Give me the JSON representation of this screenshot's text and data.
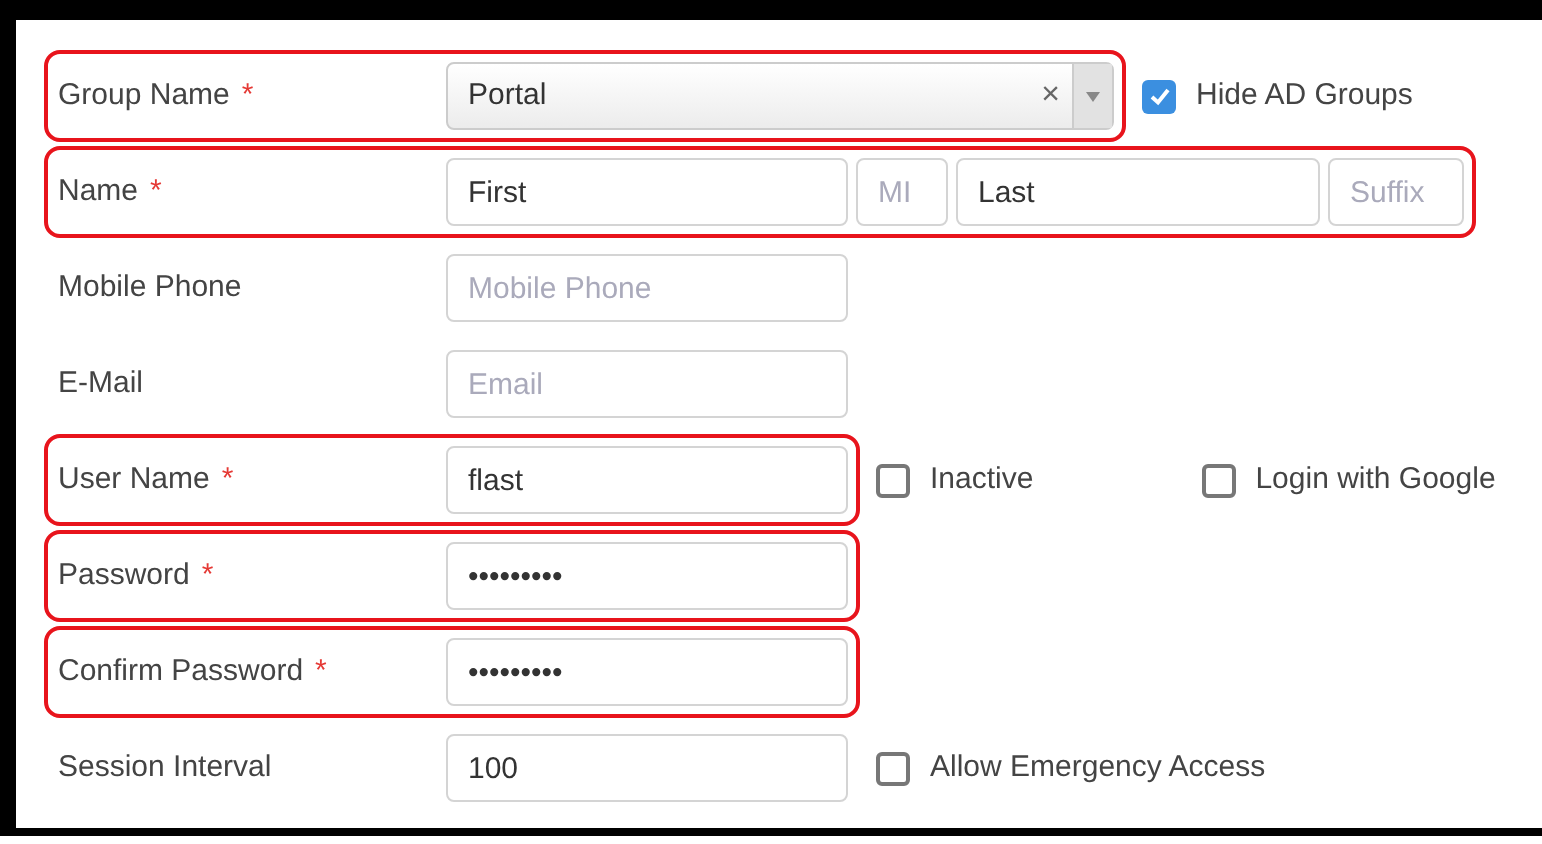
{
  "form": {
    "rows": [
      {
        "kind": "select",
        "label": "Group Name",
        "marker": "*",
        "highlighted": true,
        "value": "Portal",
        "clear": "×",
        "checkboxes": [
          {
            "label": "Hide AD Groups",
            "checked": true
          }
        ]
      },
      {
        "kind": "inputs",
        "label": "Name",
        "marker": "*",
        "highlighted": true,
        "inputs": [
          {
            "kind": "wide",
            "value": "First"
          },
          {
            "kind": "narrow",
            "placeholder": "MI"
          },
          {
            "kind": "medium",
            "value": "Last"
          },
          {
            "kind": "small",
            "placeholder": "Suffix"
          }
        ]
      },
      {
        "kind": "inputs",
        "label": "Mobile Phone",
        "highlighted": false,
        "inputs": [
          {
            "kind": "wide",
            "placeholder": "Mobile Phone"
          }
        ]
      },
      {
        "kind": "inputs",
        "label": "E-Mail",
        "highlighted": false,
        "inputs": [
          {
            "kind": "wide",
            "placeholder": "Email"
          }
        ]
      },
      {
        "kind": "inputs",
        "label": "User Name",
        "marker": "*",
        "highlighted": true,
        "inputs": [
          {
            "kind": "wide",
            "value": "flast"
          }
        ],
        "checkboxes": [
          {
            "label": "Inactive",
            "checked": false
          },
          {
            "label": "Login with Google",
            "checked": false
          }
        ]
      },
      {
        "kind": "inputs",
        "label": "Password",
        "marker": "*",
        "highlighted": true,
        "inputs": [
          {
            "kind": "wide",
            "value": "•••••••••"
          }
        ]
      },
      {
        "kind": "inputs",
        "label": "Confirm Password",
        "marker": "*",
        "highlighted": true,
        "inputs": [
          {
            "kind": "wide",
            "value": "•••••••••"
          }
        ]
      },
      {
        "kind": "inputs",
        "label": "Session Interval",
        "highlighted": false,
        "inputs": [
          {
            "kind": "wide",
            "value": "100"
          }
        ],
        "checkboxes": [
          {
            "label": "Allow Emergency Access",
            "checked": false
          }
        ]
      }
    ]
  }
}
